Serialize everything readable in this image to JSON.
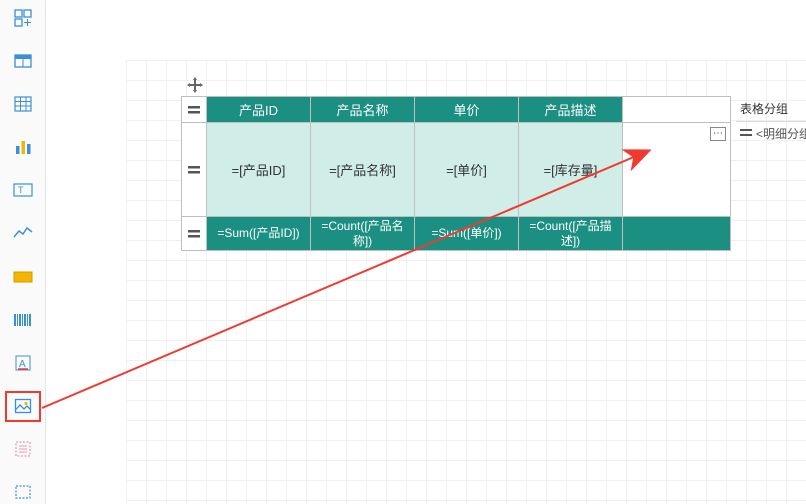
{
  "sidebar": {
    "items": [
      {
        "name": "layout-icon"
      },
      {
        "name": "table-icon"
      },
      {
        "name": "matrix-icon"
      },
      {
        "name": "chart-icon"
      },
      {
        "name": "textbox-icon"
      },
      {
        "name": "line-chart-icon"
      },
      {
        "name": "rectangle-icon"
      },
      {
        "name": "barcode-icon"
      },
      {
        "name": "richtext-icon"
      },
      {
        "name": "image-icon"
      },
      {
        "name": "subreport-icon"
      },
      {
        "name": "container-icon"
      }
    ]
  },
  "table": {
    "headers": [
      "产品ID",
      "产品名称",
      "单价",
      "产品描述",
      ""
    ],
    "data_row": [
      "=[产品ID]",
      "=[产品名称]",
      "=[单价]",
      "=[库存量]",
      ""
    ],
    "footer_row": [
      "=Sum([产品ID])",
      "=Count([产品名称])",
      "=Sum([单价])",
      "=Count([产品描述])",
      ""
    ],
    "ellipsis": "⋯"
  },
  "right_panel": {
    "title": "表格分组",
    "group_item": "<明细分组>"
  }
}
